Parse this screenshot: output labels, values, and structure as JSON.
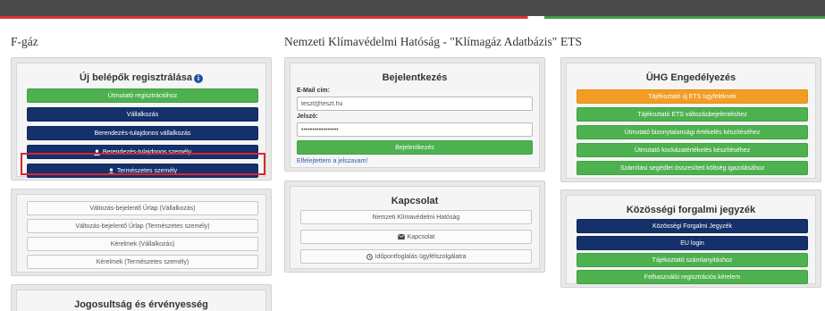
{
  "columns": {
    "fgaz_title": "F-gáz",
    "nkh_title": "Nemzeti Klímavédelmi Hatóság - \"Klímagáz Adatbázis\"",
    "ets_title": "ETS"
  },
  "registration": {
    "title": "Új belépők regisztrálása",
    "guide": "Útmutató regisztrációhoz",
    "company": "Vállalkozás",
    "owner_company": "Berendezés-tulajdonos vállalkozás",
    "owner_person": "Berendezés-tulajdonos személy",
    "natural_person": "Természetes személy"
  },
  "forms": {
    "change_company": "Változás-bejelentő Űrlap (Vállalkozás)",
    "change_person": "Változás-bejelentő Űrlap (Természetes személy)",
    "requests_company": "Kérelmek (Vállalkozás)",
    "requests_person": "Kérelmek (Természetes személy)"
  },
  "validity": {
    "title": "Jogosultság és érvényesség"
  },
  "login": {
    "title": "Bejelentkezés",
    "email_label": "E-Mail cím:",
    "email_value": "teszt@teszt.hu",
    "password_label": "Jelszó:",
    "password_value": "•••••••••••••••••",
    "submit": "Bejelentkezés",
    "forgot": "Elfelejtettem a jelszavam!"
  },
  "contact": {
    "title": "Kapcsolat",
    "authority": "Nemzeti Klímavédelmi Hatóság",
    "contact": "Kapcsolat",
    "booking": "Időpontfoglalás ügyfélszolgálatra"
  },
  "uhg": {
    "title": "ÜHG Engedélyezés",
    "b1": "Tájékoztató új ETS ügyfeleknek",
    "b2": "Tájékoztató ETS változásbejelentéshez",
    "b3": "Útmutató bizonytalansági értékelés készítéséhez",
    "b4": "Útmutató kockázatértékelés készítéséhez",
    "b5": "Számítási segédlet összesített költség igazolásához"
  },
  "registry": {
    "title": "Közösségi forgalmi jegyzék",
    "b1": "Közösségi Forgalmi Jegyzék",
    "b2": "EU login",
    "b3": "Tájékoztató számlanyitáshoz",
    "b4": "Felhasználói regisztrációs kérelem"
  },
  "colors": {
    "green": "#4db14f",
    "navy": "#15316b",
    "orange": "#f39c24",
    "highlight": "#d9262e"
  }
}
